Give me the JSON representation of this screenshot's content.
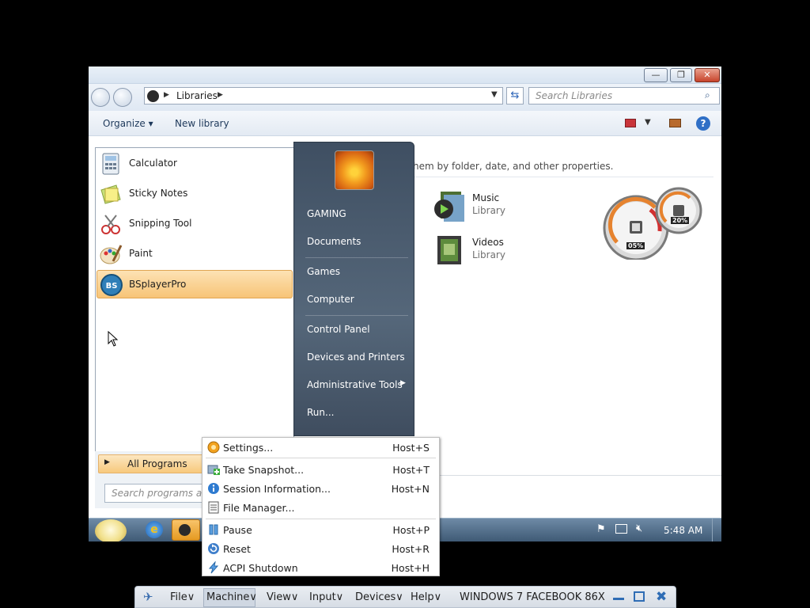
{
  "explorer": {
    "address_crumb": "Libraries",
    "search_placeholder": "Search Libraries",
    "toolbar_organize": "Organize",
    "toolbar_new_library": "New library",
    "content_hint": "hem by folder, date, and other properties.",
    "libraries": [
      {
        "name": "Music",
        "sub": "Library"
      },
      {
        "name": "Videos",
        "sub": "Library"
      }
    ]
  },
  "gadget": {
    "cpu": "05%",
    "memory": "20%"
  },
  "start_menu": {
    "programs": [
      {
        "label": "Calculator"
      },
      {
        "label": "Sticky Notes"
      },
      {
        "label": "Snipping Tool"
      },
      {
        "label": "Paint"
      },
      {
        "label": "BSplayerPro"
      }
    ],
    "right_items": [
      {
        "label": "GAMING"
      },
      {
        "label": "Documents"
      },
      {
        "label": "Games"
      },
      {
        "label": "Computer"
      },
      {
        "label": "Control Panel"
      },
      {
        "label": "Devices and Printers"
      },
      {
        "label": "Administrative Tools"
      },
      {
        "label": "Run..."
      }
    ],
    "all_programs": "All Programs",
    "search_placeholder": "Search programs and"
  },
  "taskbar": {
    "clock": "5:48 AM"
  },
  "machine_menu": {
    "items": [
      {
        "label": "Settings...",
        "key": "Host+S",
        "icon": "settings-icon"
      },
      {
        "label": "Take Snapshot...",
        "key": "Host+T",
        "icon": "snapshot-icon"
      },
      {
        "label": "Session Information...",
        "key": "Host+N",
        "icon": "info-icon"
      },
      {
        "label": "File Manager...",
        "key": "",
        "icon": "file-manager-icon"
      },
      {
        "label": "Pause",
        "key": "Host+P",
        "icon": "pause-icon"
      },
      {
        "label": "Reset",
        "key": "Host+R",
        "icon": "reset-icon"
      },
      {
        "label": "ACPI Shutdown",
        "key": "Host+H",
        "icon": "shutdown-icon"
      }
    ]
  },
  "vbox_bar": {
    "menus": [
      "File",
      "Machine",
      "View",
      "Input",
      "Devices",
      "Help"
    ],
    "vm_title": "WINDOWS 7 FACEBOOK 86X"
  }
}
